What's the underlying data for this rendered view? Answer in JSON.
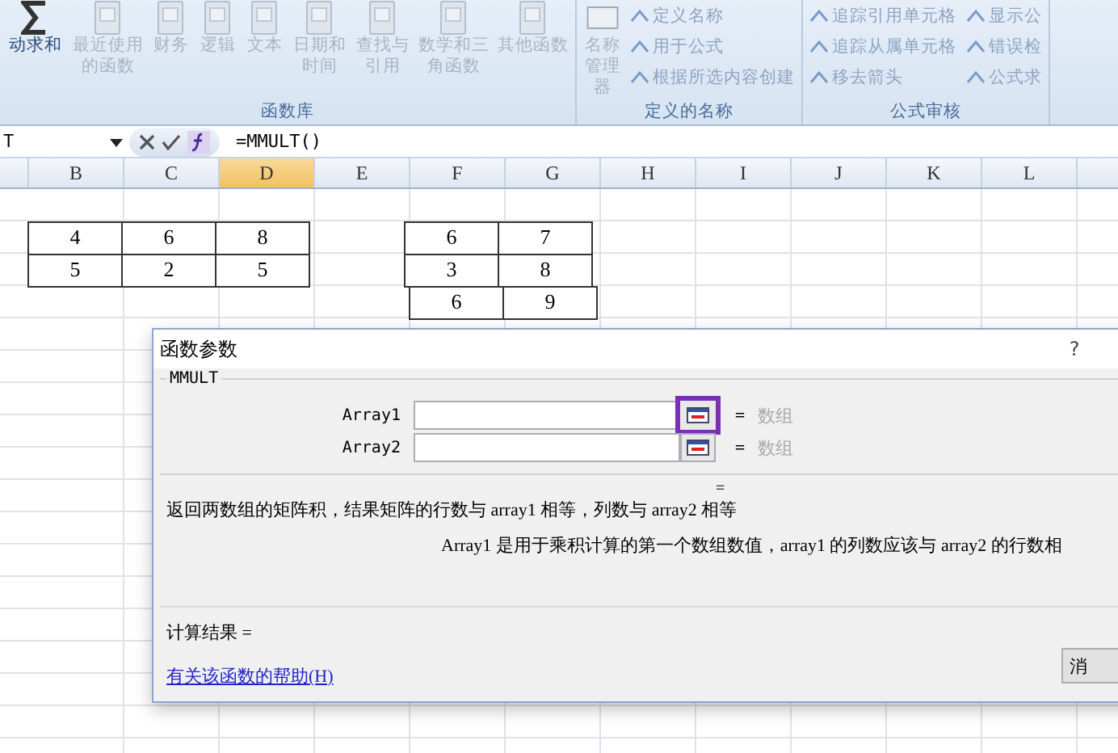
{
  "ribbon": {
    "groups": [
      {
        "label": "函数库",
        "items": [
          {
            "label": "动求和",
            "kind": "sum"
          },
          {
            "label": "最近使用的函数",
            "kind": "book"
          },
          {
            "label": "财务",
            "kind": "book"
          },
          {
            "label": "逻辑",
            "kind": "book"
          },
          {
            "label": "文本",
            "kind": "book"
          },
          {
            "label": "日期和时间",
            "kind": "book"
          },
          {
            "label": "查找与引用",
            "kind": "book"
          },
          {
            "label": "数学和三角函数",
            "kind": "book"
          },
          {
            "label": "其他函数",
            "kind": "book"
          }
        ]
      },
      {
        "label": "定义的名称",
        "items": [
          {
            "label": "名称管理器",
            "kind": "big"
          },
          {
            "label": "定义名称",
            "kind": "small"
          },
          {
            "label": "用于公式",
            "kind": "small"
          },
          {
            "label": "根据所选内容创建",
            "kind": "small"
          }
        ]
      },
      {
        "label": "公式审核",
        "items": [
          {
            "label": "追踪引用单元格",
            "kind": "small"
          },
          {
            "label": "追踪从属单元格",
            "kind": "small"
          },
          {
            "label": "移去箭头",
            "kind": "small"
          },
          {
            "label": "显示公",
            "kind": "small"
          },
          {
            "label": "错误检",
            "kind": "small"
          },
          {
            "label": "公式求",
            "kind": "small"
          }
        ]
      }
    ]
  },
  "formula_bar": {
    "name_box": "T",
    "formula": "=MMULT()"
  },
  "columns": [
    {
      "label": "B",
      "selected": false
    },
    {
      "label": "C",
      "selected": false
    },
    {
      "label": "D",
      "selected": true
    },
    {
      "label": "E",
      "selected": false
    },
    {
      "label": "F",
      "selected": false
    },
    {
      "label": "G",
      "selected": false
    },
    {
      "label": "H",
      "selected": false
    },
    {
      "label": "I",
      "selected": false
    },
    {
      "label": "J",
      "selected": false
    },
    {
      "label": "K",
      "selected": false
    },
    {
      "label": "L",
      "selected": false
    }
  ],
  "tables": [
    {
      "rows": [
        [
          "4",
          "6",
          "8"
        ],
        [
          "5",
          "2",
          "5"
        ]
      ]
    },
    {
      "rows": [
        [
          "6",
          "7"
        ],
        [
          "3",
          "8"
        ],
        [
          "6",
          "9"
        ]
      ]
    }
  ],
  "dialog": {
    "title": "函数参数",
    "help": "?",
    "function_name": "MMULT",
    "arguments": [
      {
        "label": "Array1",
        "equals": "=",
        "hint": "数组",
        "highlighted": true
      },
      {
        "label": "Array2",
        "equals": "=",
        "hint": "数组",
        "highlighted": false
      }
    ],
    "result_equals": "=",
    "description": "返回两数组的矩阵积，结果矩阵的行数与 array1 相等，列数与 array2 相等",
    "argument_description": "Array1  是用于乘积计算的第一个数组数值，array1 的列数应该与 array2 的行数相",
    "result_label": "计算结果 =",
    "help_link": "有关该函数的帮助(H)",
    "button": "消"
  }
}
